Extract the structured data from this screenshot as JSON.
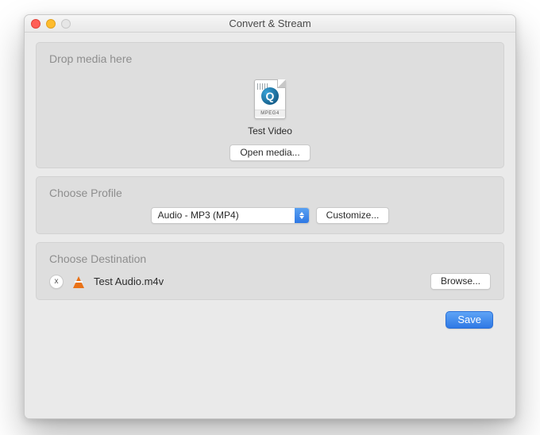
{
  "window": {
    "title": "Convert & Stream"
  },
  "drop": {
    "heading": "Drop media here",
    "media_name": "Test Video",
    "format_badge": "MPEG4",
    "open_label": "Open media..."
  },
  "profile": {
    "heading": "Choose Profile",
    "selected": "Audio - MP3 (MP4)",
    "customize_label": "Customize..."
  },
  "destination": {
    "heading": "Choose Destination",
    "clear_label": "x",
    "filename": "Test Audio.m4v",
    "browse_label": "Browse..."
  },
  "footer": {
    "save_label": "Save"
  }
}
